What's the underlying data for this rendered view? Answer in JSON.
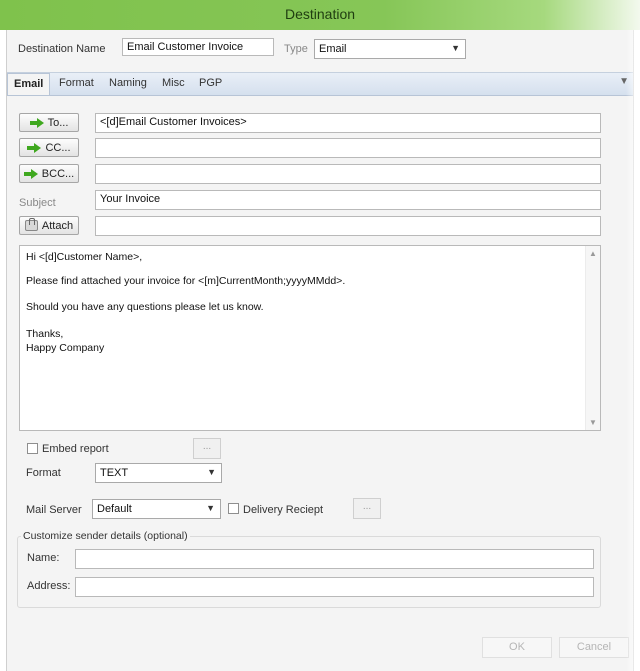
{
  "window": {
    "title": "Destination"
  },
  "header": {
    "destination_name_label": "Destination Name",
    "destination_name_value": "Email Customer Invoice",
    "type_label": "Type",
    "type_value": "Email"
  },
  "tabs": [
    {
      "label": "Email",
      "active": true
    },
    {
      "label": "Format"
    },
    {
      "label": "Naming"
    },
    {
      "label": "Misc"
    },
    {
      "label": "PGP"
    }
  ],
  "recipients": {
    "to_label": "To...",
    "to_value": "<[d]Email Customer Invoices>",
    "cc_label": "CC...",
    "cc_value": "",
    "bcc_label": "BCC...",
    "bcc_value": "",
    "subject_label": "Subject",
    "subject_value": "Your Invoice",
    "attach_label": "Attach",
    "attach_value": ""
  },
  "message": {
    "lines": [
      "Hi <[d]Customer Name>,",
      "Please find attached your invoice for <[m]CurrentMonth;yyyyMMdd>.",
      "Should you have any questions please let us know.",
      "Thanks,",
      "Happy Company"
    ]
  },
  "options": {
    "embed_report_label": "Embed report",
    "embed_ellipsis": "...",
    "format_label": "Format",
    "format_value": "TEXT",
    "mail_server_label": "Mail Server",
    "mail_server_value": "Default",
    "delivery_receipt_label": "Delivery Reciept",
    "delivery_ellipsis": "..."
  },
  "sender": {
    "group_label": "Customize sender details (optional)",
    "name_label": "Name:",
    "name_value": "",
    "address_label": "Address:",
    "address_value": ""
  },
  "footer": {
    "ok_label": "OK",
    "cancel_label": "Cancel"
  },
  "colors": {
    "titlebar": "#86c657",
    "arrow": "#3fa81f",
    "tab_strip": "#dce5f0"
  }
}
